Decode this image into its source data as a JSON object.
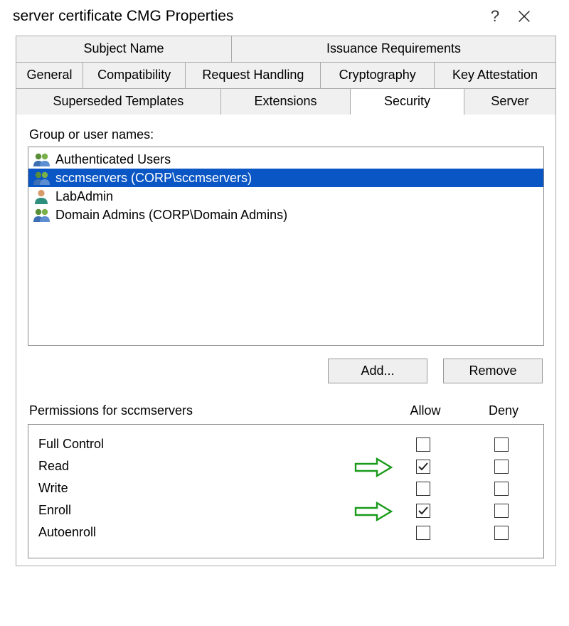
{
  "title": "server certificate CMG Properties",
  "tabs_row1": [
    {
      "label": "Subject Name",
      "weight": 40
    },
    {
      "label": "Issuance Requirements",
      "weight": 60
    }
  ],
  "tabs_row2": [
    {
      "label": "General",
      "weight": 12.5
    },
    {
      "label": "Compatibility",
      "weight": 19
    },
    {
      "label": "Request Handling",
      "weight": 25
    },
    {
      "label": "Cryptography",
      "weight": 21
    },
    {
      "label": "Key Attestation",
      "weight": 22.5
    }
  ],
  "tabs_row3": [
    {
      "label": "Superseded Templates",
      "weight": 38,
      "active": false
    },
    {
      "label": "Extensions",
      "weight": 24,
      "active": false
    },
    {
      "label": "Security",
      "weight": 21,
      "active": true
    },
    {
      "label": "Server",
      "weight": 17,
      "active": false
    }
  ],
  "group_label": "Group or user names:",
  "principals": [
    {
      "icon": "group",
      "name": "Authenticated Users",
      "selected": false
    },
    {
      "icon": "group",
      "name": "sccmservers (CORP\\sccmservers)",
      "selected": true
    },
    {
      "icon": "user",
      "name": "LabAdmin",
      "selected": false
    },
    {
      "icon": "group",
      "name": "Domain Admins (CORP\\Domain Admins)",
      "selected": false
    }
  ],
  "buttons": {
    "add": "Add...",
    "remove": "Remove"
  },
  "perm_label": "Permissions for sccmservers",
  "perm_cols": {
    "allow": "Allow",
    "deny": "Deny"
  },
  "permissions": [
    {
      "name": "Full Control",
      "allow": false,
      "deny": false,
      "arrow": false
    },
    {
      "name": "Read",
      "allow": true,
      "deny": false,
      "arrow": true
    },
    {
      "name": "Write",
      "allow": false,
      "deny": false,
      "arrow": false
    },
    {
      "name": "Enroll",
      "allow": true,
      "deny": false,
      "arrow": true
    },
    {
      "name": "Autoenroll",
      "allow": false,
      "deny": false,
      "arrow": false
    }
  ]
}
